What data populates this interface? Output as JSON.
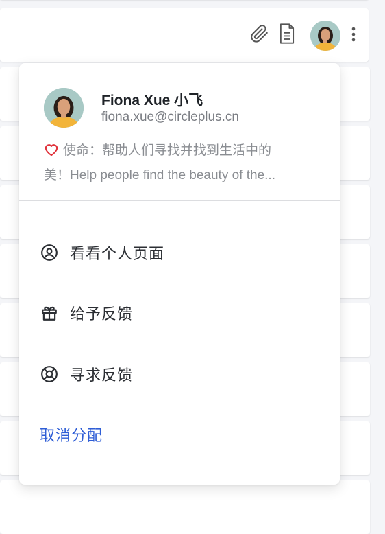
{
  "toolbar": {
    "attachment_icon": "paperclip-icon",
    "document_icon": "document-icon",
    "avatar_alt": "avatar",
    "more_icon": "more-vertical-icon"
  },
  "profile": {
    "name": "Fiona Xue 小飞",
    "email": "fiona.xue@circleplus.cn",
    "mission_line1": "使命：帮助人们寻找并找到生活中的",
    "mission_line2": "美！Help people find the beauty of the..."
  },
  "menu": {
    "items": [
      {
        "label": "看看个人页面",
        "icon": "user-circle-icon"
      },
      {
        "label": "给予反馈",
        "icon": "gift-icon"
      },
      {
        "label": "寻求反馈",
        "icon": "lifebuoy-icon"
      }
    ],
    "unassign_label": "取消分配"
  },
  "colors": {
    "heart": "#e0313a",
    "link": "#2f5ed6",
    "avatar_bg": "#9fc3c0",
    "shirt": "#f2b43a"
  }
}
